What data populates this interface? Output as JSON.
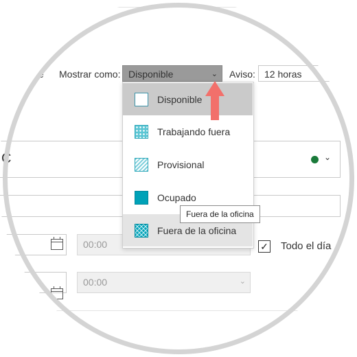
{
  "form": {
    "cut_label": "e",
    "show_as_label": "Mostrar como:",
    "show_as_value": "Disponible",
    "reminder_label": "Aviso:",
    "reminder_value": "12 horas",
    "calendar_row_text": "C",
    "start_time": "00:00",
    "end_time": "00:00",
    "all_day_label": "Todo el día",
    "all_day_checked": true
  },
  "status_options": [
    {
      "label": "Disponible",
      "icon": "free-swatch-icon",
      "state": "selected"
    },
    {
      "label": "Trabajando fuera",
      "icon": "working-elsewhere-swatch-icon",
      "state": "normal"
    },
    {
      "label": "Provisional",
      "icon": "tentative-swatch-icon",
      "state": "normal"
    },
    {
      "label": "Ocupado",
      "icon": "busy-swatch-icon",
      "state": "normal"
    },
    {
      "label": "Fuera de la oficina",
      "icon": "out-of-office-swatch-icon",
      "state": "hover"
    }
  ],
  "tooltip": "Fuera de la oficina",
  "colors": {
    "accent_teal": "#00a2b8",
    "calendar_dot": "#1a7a3a",
    "arrow": "#f2706b"
  }
}
